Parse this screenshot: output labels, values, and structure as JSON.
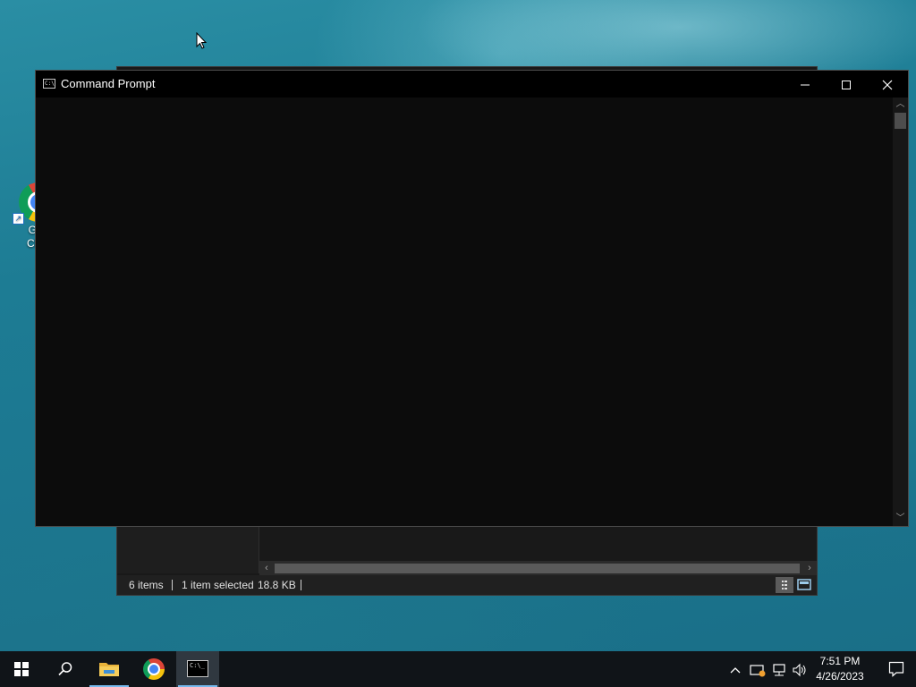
{
  "desktop": {
    "icons": [
      {
        "label_line1": "Goo",
        "label_line2": "Chro",
        "icon": "chrome-icon"
      }
    ]
  },
  "cmd_window": {
    "title": "Command Prompt",
    "icon": "cmd-icon",
    "minimize_label": "—",
    "maximize_label": "☐",
    "close_label": "✕",
    "console_text": ""
  },
  "explorer_window": {
    "status": {
      "items": "6 items",
      "selected": "1 item selected",
      "size": "18.8 KB"
    }
  },
  "taskbar": {
    "apps": [
      {
        "name": "start",
        "icon": "windows-logo-icon"
      },
      {
        "name": "search",
        "icon": "search-icon"
      },
      {
        "name": "file-explorer",
        "icon": "folder-icon"
      },
      {
        "name": "google-chrome",
        "icon": "chrome-icon"
      },
      {
        "name": "command-prompt",
        "icon": "cmd-icon"
      }
    ],
    "clock": {
      "time": "7:51 PM",
      "date": "4/26/2023"
    }
  },
  "colors": {
    "accent": "#76b9ed",
    "console_bg": "#0c0c0c",
    "taskbar_bg": "#101418"
  }
}
